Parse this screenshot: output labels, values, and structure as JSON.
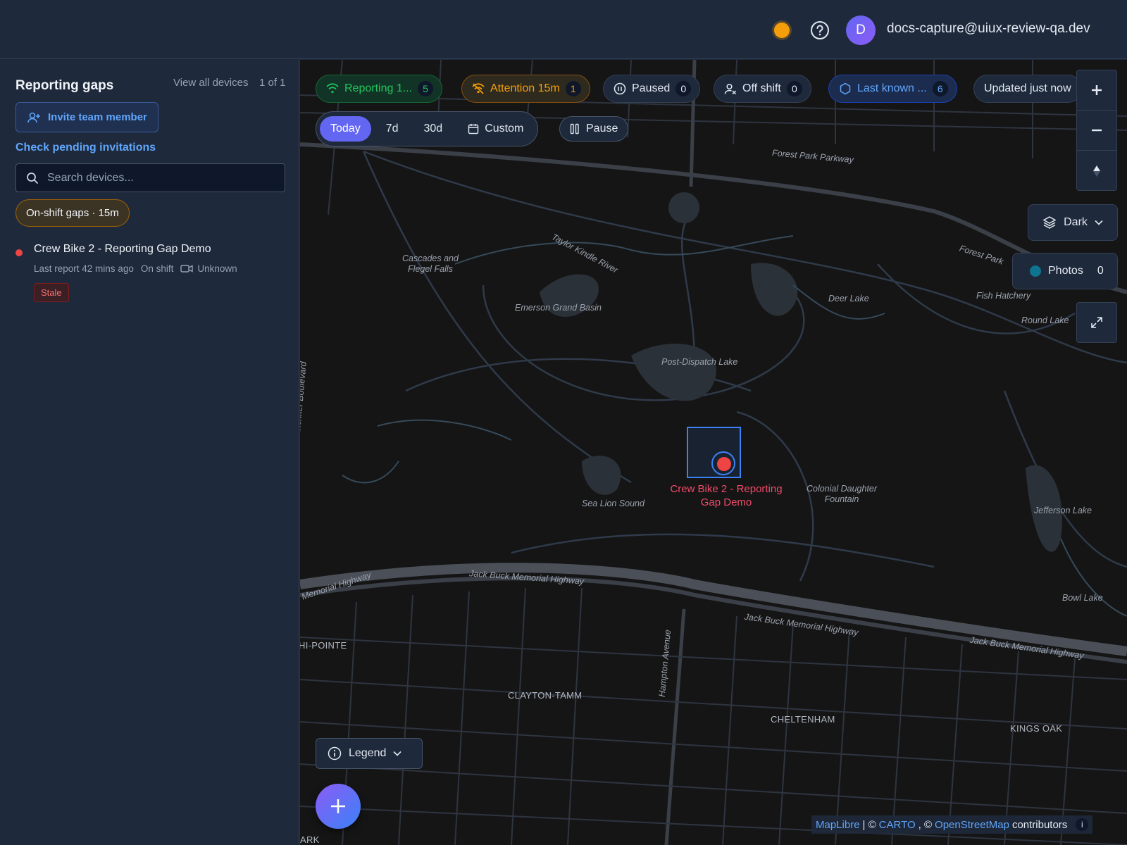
{
  "header": {
    "user_initial": "D",
    "user_email": "docs-capture@uiux-review-qa.dev"
  },
  "sidebar": {
    "title": "Reporting gaps",
    "view_all": "View all devices",
    "pagination": "1 of 1",
    "invite_label": "Invite team member",
    "pending_link": "Check pending invitations",
    "search_placeholder": "Search devices...",
    "filter_chip": "On-shift gaps · 15m",
    "devices": [
      {
        "name": "Crew Bike 2 - Reporting Gap Demo",
        "last_report": "Last report 42 mins ago",
        "shift": "On shift",
        "camera": "Unknown",
        "badge": "Stale"
      }
    ]
  },
  "map": {
    "status_pills": [
      {
        "label": "Reporting 1...",
        "count": "5",
        "color": "#22c55e"
      },
      {
        "label": "Attention 15m",
        "count": "1",
        "color": "#f59e0b"
      },
      {
        "label": "Paused",
        "count": "0"
      },
      {
        "label": "Off shift",
        "count": "0"
      },
      {
        "label": "Last known ...",
        "count": "6",
        "color": "#60a5fa"
      }
    ],
    "updated": "Updated just now",
    "ranges": [
      "Today",
      "7d",
      "30d",
      "Custom"
    ],
    "active_range": "Today",
    "pause_label": "Pause",
    "style_label": "Dark",
    "photos_label": "Photos",
    "photos_count": "0",
    "legend_label": "Legend",
    "marker_label": "Crew Bike 2 - Reporting Gap Demo",
    "attribution": {
      "maplibre": "MapLibre",
      "sep1": "| ©",
      "carto": "CARTO",
      "sep2": ", ©",
      "osm": "OpenStreetMap",
      "tail": "contributors"
    },
    "labels": {
      "forest_park_parkway": "Forest Park Parkway",
      "forest_park_2": "Forest Park",
      "cascades": "Cascades and Flegel Falls",
      "taylor": "Taylor Kindle River",
      "emerson": "Emerson Grand Basin",
      "deer_lake": "Deer Lake",
      "fish_hatchery": "Fish Hatchery",
      "round_lake": "Round Lake",
      "post_dispatch": "Post-Dispatch Lake",
      "south_skinker": "South Skinker Boulevard",
      "sea_lion": "Sea Lion Sound",
      "colonial": "Colonial Daughter Fountain",
      "jefferson_lake": "Jefferson Lake",
      "bowl_lake": "Bowl Lake",
      "jack_buck_1": "Jack Buck Memorial Highway",
      "jack_buck_2": "Memorial Highway",
      "jack_buck_3": "Jack Buck Memorial Highway",
      "jack_buck_4": "Jack Buck Memorial Highway",
      "hampton": "Hampton Avenue",
      "hi_pointe": "HI-POINTE",
      "clayton": "CLAYTON-TAMM",
      "cheltenham": "CHELTENHAM",
      "kings_oak": "KINGS OAK",
      "ark": "ARK"
    }
  }
}
